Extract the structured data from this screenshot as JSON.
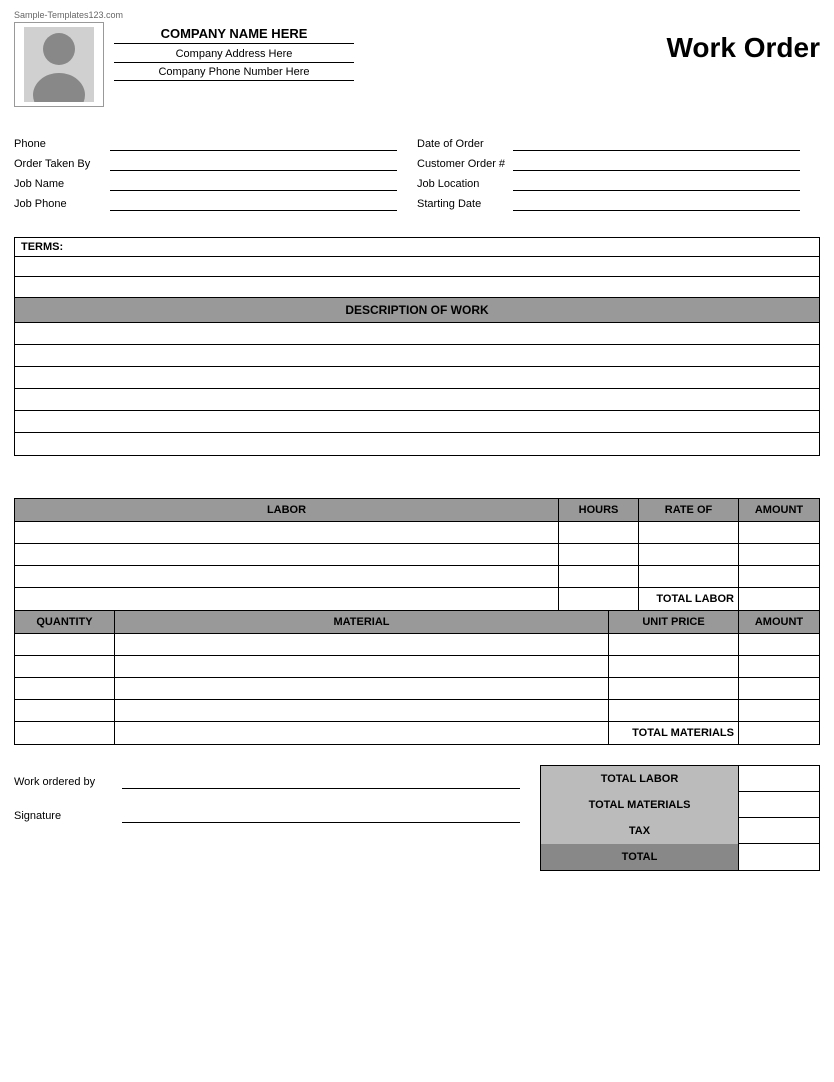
{
  "watermark": "Sample-Templates123.com",
  "header": {
    "company_name": "COMPANY NAME HERE",
    "company_address": "Company Address Here",
    "company_phone": "Company Phone Number Here",
    "title": "Work Order"
  },
  "form": {
    "left": [
      {
        "label": "Phone",
        "id": "phone"
      },
      {
        "label": "Order Taken By",
        "id": "order-taken-by"
      },
      {
        "label": "Job Name",
        "id": "job-name"
      },
      {
        "label": "Job Phone",
        "id": "job-phone"
      }
    ],
    "right": [
      {
        "label": "Date of Order",
        "id": "date-of-order"
      },
      {
        "label": "Customer Order #",
        "id": "customer-order"
      },
      {
        "label": "Job Location",
        "id": "job-location"
      },
      {
        "label": "Starting Date",
        "id": "starting-date"
      }
    ]
  },
  "terms": {
    "label": "TERMS:"
  },
  "description": {
    "header": "DESCRIPTION OF WORK",
    "rows": 6
  },
  "labor": {
    "columns": [
      "LABOR",
      "HOURS",
      "RATE OF",
      "AMOUNT"
    ],
    "rows": 3,
    "total_label": "TOTAL LABOR"
  },
  "materials": {
    "columns": [
      "QUANTITY",
      "MATERIAL",
      "UNIT PRICE",
      "AMOUNT"
    ],
    "rows": 4,
    "total_label": "TOTAL MATERIALS"
  },
  "bottom": {
    "work_ordered_by": "Work ordered by",
    "signature": "Signature"
  },
  "totals": [
    {
      "label": "TOTAL LABOR",
      "id": "total-labor-sum"
    },
    {
      "label": "TOTAL MATERIALS",
      "id": "total-materials-sum"
    },
    {
      "label": "TAX",
      "id": "tax"
    },
    {
      "label": "TOTAL",
      "id": "grand-total",
      "bold": true
    }
  ]
}
